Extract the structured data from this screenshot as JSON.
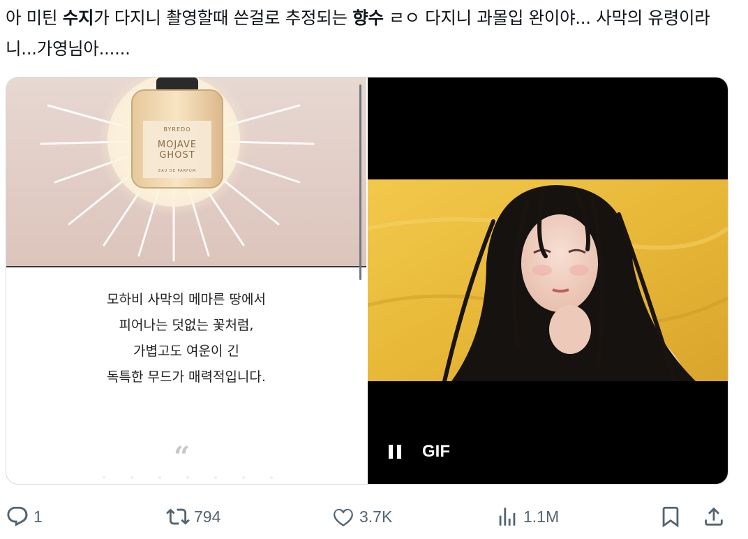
{
  "tweet": {
    "text_1": "아 미틴 ",
    "text_bold_1": "수지",
    "text_2": "가 다지니 촬영할때 쓴걸로 추정되는 ",
    "text_bold_2": "향수",
    "text_3": " ㄹㅇ 다지니 과몰입 완이야... 사막의 유령이라니...가영님아......"
  },
  "media": {
    "perfume": {
      "brand": "BYREDO",
      "name_line1": "MOJAVE",
      "name_line2": "GHOST",
      "subtitle": "EAU DE PARFUM"
    },
    "description_lines": [
      "모하비 사막의 메마른 땅에서",
      "피어나는 덧없는 꽃처럼,",
      "가볍고도 여운이 긴",
      "독특한 무드가 매력적입니다."
    ],
    "quote_mark": "“",
    "gif_label": "GIF"
  },
  "actions": {
    "replies": "1",
    "reposts": "794",
    "likes": "3.7K",
    "views": "1.1M"
  },
  "colors": {
    "text": "#0f1419",
    "muted": "#536471",
    "border": "#cfd9de",
    "desert_yellow": "#e6b83a"
  }
}
